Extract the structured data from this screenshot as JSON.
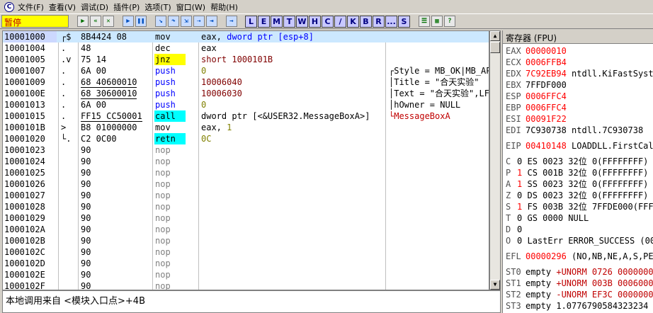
{
  "menu": {
    "app_icon": "C",
    "items": [
      "文件(F)",
      "查看(V)",
      "调试(D)",
      "插件(P)",
      "选项(T)",
      "窗口(W)",
      "帮助(H)"
    ]
  },
  "toolbar": {
    "status": "暂停",
    "buttons": [
      "open-icon",
      "restart-icon",
      "close-icon",
      "run-icon",
      "pause-icon",
      "step-into-icon",
      "step-over-icon",
      "trace-into-icon",
      "trace-over-icon",
      "execute-till-return-icon",
      "go-to-icon"
    ],
    "letters": [
      "L",
      "E",
      "M",
      "T",
      "W",
      "H",
      "C",
      "/",
      "K",
      "B",
      "R",
      "...",
      "S"
    ],
    "right_buttons": [
      "list-icon",
      "grid-icon",
      "help-icon"
    ]
  },
  "disasm": {
    "rows": [
      {
        "addr": "10001000",
        "mark": "┌$",
        "hex": "8B4424 08",
        "mn": "mov",
        "mn_style": "",
        "ops": [
          {
            "t": "eax, ",
            "c": ""
          },
          {
            "t": "dword ptr [esp+8]",
            "c": "kw-blue"
          }
        ],
        "cmt": "",
        "sel": true
      },
      {
        "addr": "10001004",
        "mark": ".",
        "hex": "48",
        "mn": "dec",
        "mn_style": "",
        "ops": [
          {
            "t": "eax",
            "c": ""
          }
        ],
        "cmt": ""
      },
      {
        "addr": "10001005",
        "mark": ".v",
        "hex": "75 14",
        "mn": "jnz",
        "mn_style": "hl-jump",
        "ops": [
          {
            "t": "short 1000101B",
            "c": "num"
          }
        ],
        "cmt": ""
      },
      {
        "addr": "10001007",
        "mark": ".",
        "hex": "6A 00",
        "mn": "push",
        "mn_style": "kw-blue",
        "ops": [
          {
            "t": "0",
            "c": "kw-olive"
          }
        ],
        "cmt": "┌Style = MB_OK|MB_APPLMODAL"
      },
      {
        "addr": "10001009",
        "mark": ".",
        "hex": "68 40600010",
        "hex_ul": true,
        "mn": "push",
        "mn_style": "kw-blue",
        "ops": [
          {
            "t": "10006040",
            "c": "num"
          }
        ],
        "cmt": "│Title = \"合天实验\""
      },
      {
        "addr": "1000100E",
        "mark": ".",
        "hex": "68 30600010",
        "hex_ul": true,
        "mn": "push",
        "mn_style": "kw-blue",
        "ops": [
          {
            "t": "10006030",
            "c": "num"
          }
        ],
        "cmt": "│Text = \"合天实验\",LF,\"Hello\""
      },
      {
        "addr": "10001013",
        "mark": ".",
        "hex": "6A 00",
        "mn": "push",
        "mn_style": "kw-blue",
        "ops": [
          {
            "t": "0",
            "c": "kw-olive"
          }
        ],
        "cmt": "│hOwner = NULL"
      },
      {
        "addr": "10001015",
        "mark": ".",
        "hex": "FF15 CC50001",
        "hex_ul": true,
        "mn": "call",
        "mn_style": "hl-call",
        "ops": [
          {
            "t": "dword ptr [<&USER32.MessageBoxA>]",
            "c": ""
          }
        ],
        "cmt": "└MessageBoxA",
        "cmt_red": true
      },
      {
        "addr": "1000101B",
        "mark": ">",
        "hex": "B8 01000000",
        "mn": "mov",
        "mn_style": "",
        "ops": [
          {
            "t": "eax, ",
            "c": ""
          },
          {
            "t": "1",
            "c": "kw-olive"
          }
        ],
        "cmt": ""
      },
      {
        "addr": "10001020",
        "mark": "└.",
        "hex": "C2 0C00",
        "mn": "retn",
        "mn_style": "hl-ret",
        "ops": [
          {
            "t": "0C",
            "c": "kw-olive"
          }
        ],
        "cmt": ""
      },
      {
        "addr": "10001023",
        "mark": "",
        "hex": "90",
        "mn": "nop",
        "mn_style": "nop",
        "ops": [],
        "cmt": ""
      },
      {
        "addr": "10001024",
        "mark": "",
        "hex": "90",
        "mn": "nop",
        "mn_style": "nop",
        "ops": [],
        "cmt": ""
      },
      {
        "addr": "10001025",
        "mark": "",
        "hex": "90",
        "mn": "nop",
        "mn_style": "nop",
        "ops": [],
        "cmt": ""
      },
      {
        "addr": "10001026",
        "mark": "",
        "hex": "90",
        "mn": "nop",
        "mn_style": "nop",
        "ops": [],
        "cmt": ""
      },
      {
        "addr": "10001027",
        "mark": "",
        "hex": "90",
        "mn": "nop",
        "mn_style": "nop",
        "ops": [],
        "cmt": ""
      },
      {
        "addr": "10001028",
        "mark": "",
        "hex": "90",
        "mn": "nop",
        "mn_style": "nop",
        "ops": [],
        "cmt": ""
      },
      {
        "addr": "10001029",
        "mark": "",
        "hex": "90",
        "mn": "nop",
        "mn_style": "nop",
        "ops": [],
        "cmt": ""
      },
      {
        "addr": "1000102A",
        "mark": "",
        "hex": "90",
        "mn": "nop",
        "mn_style": "nop",
        "ops": [],
        "cmt": ""
      },
      {
        "addr": "1000102B",
        "mark": "",
        "hex": "90",
        "mn": "nop",
        "mn_style": "nop",
        "ops": [],
        "cmt": ""
      },
      {
        "addr": "1000102C",
        "mark": "",
        "hex": "90",
        "mn": "nop",
        "mn_style": "nop",
        "ops": [],
        "cmt": ""
      },
      {
        "addr": "1000102D",
        "mark": "",
        "hex": "90",
        "mn": "nop",
        "mn_style": "nop",
        "ops": [],
        "cmt": ""
      },
      {
        "addr": "1000102E",
        "mark": "",
        "hex": "90",
        "mn": "nop",
        "mn_style": "nop",
        "ops": [],
        "cmt": ""
      },
      {
        "addr": "1000102F",
        "mark": "",
        "hex": "90",
        "mn": "nop",
        "mn_style": "nop",
        "ops": [],
        "cmt": ""
      }
    ]
  },
  "info": {
    "text": "本地调用来自 <模块入口点>+4B"
  },
  "registers": {
    "title": "寄存器 (FPU)",
    "rows": [
      {
        "n": "EAX",
        "v": "00000010",
        "ch": true,
        "i": ""
      },
      {
        "n": "ECX",
        "v": "0006FFB4",
        "ch": true,
        "i": ""
      },
      {
        "n": "EDX",
        "v": "7C92EB94",
        "ch": true,
        "i": "ntdll.KiFastSystemCallRet"
      },
      {
        "n": "EBX",
        "v": "7FFDF000",
        "ch": false,
        "i": ""
      },
      {
        "n": "ESP",
        "v": "0006FFC4",
        "ch": true,
        "i": ""
      },
      {
        "n": "EBP",
        "v": "0006FFC4",
        "ch": true,
        "i": ""
      },
      {
        "n": "ESI",
        "v": "00091F22",
        "ch": true,
        "i": ""
      },
      {
        "n": "EDI",
        "v": "7C930738",
        "ch": false,
        "i": "ntdll.7C930738"
      },
      {
        "n": "",
        "v": "",
        "ch": false,
        "i": ""
      },
      {
        "n": "EIP",
        "v": "00410148",
        "ch": true,
        "i": "LOADDLL.FirstCall"
      },
      {
        "n": "",
        "v": "",
        "ch": false,
        "i": ""
      },
      {
        "n": "C",
        "v": "0",
        "ch": false,
        "i": "ES 0023 32位 0(FFFFFFFF)",
        "flag": true
      },
      {
        "n": "P",
        "v": "1",
        "ch": true,
        "i": "CS 001B 32位 0(FFFFFFFF)",
        "flag": true
      },
      {
        "n": "A",
        "v": "1",
        "ch": true,
        "i": "SS 0023 32位 0(FFFFFFFF)",
        "flag": true
      },
      {
        "n": "Z",
        "v": "0",
        "ch": false,
        "i": "DS 0023 32位 0(FFFFFFFF)",
        "flag": true
      },
      {
        "n": "S",
        "v": "1",
        "ch": true,
        "i": "FS 003B 32位 7FFDE000(FFF)",
        "flag": true,
        "seg_ch": true
      },
      {
        "n": "T",
        "v": "0",
        "ch": false,
        "i": "GS 0000 NULL",
        "flag": true
      },
      {
        "n": "D",
        "v": "0",
        "ch": false,
        "i": "",
        "flag": true
      },
      {
        "n": "O",
        "v": "0",
        "ch": false,
        "i": "LastErr ERROR_SUCCESS (00000000)",
        "flag": true
      },
      {
        "n": "",
        "v": "",
        "ch": false,
        "i": ""
      },
      {
        "n": "EFL",
        "v": "00000296",
        "ch": true,
        "i": "(NO,NB,NE,A,S,PE,L,LE)"
      },
      {
        "n": "",
        "v": "",
        "ch": false,
        "i": ""
      },
      {
        "n": "ST0",
        "v": "empty",
        "ch": false,
        "i": "+UNORM 0726 00000000 00000000",
        "fpu": true
      },
      {
        "n": "ST1",
        "v": "empty",
        "ch": false,
        "i": "+UNORM 003B 00060000 00000000",
        "fpu": true
      },
      {
        "n": "ST2",
        "v": "empty",
        "ch": false,
        "i": "-UNORM EF3C 00000000 00000000",
        "fpu": true
      },
      {
        "n": "ST3",
        "v": "empty",
        "ch": false,
        "i": "1.0776790584323234",
        "fpu": true
      }
    ]
  },
  "colors": {
    "selected_row": "#cce8ff",
    "jump_highlight": "#ffff00",
    "call_highlight": "#00ffff",
    "changed_register": "#ff0000",
    "status_background": "#ffff00"
  }
}
